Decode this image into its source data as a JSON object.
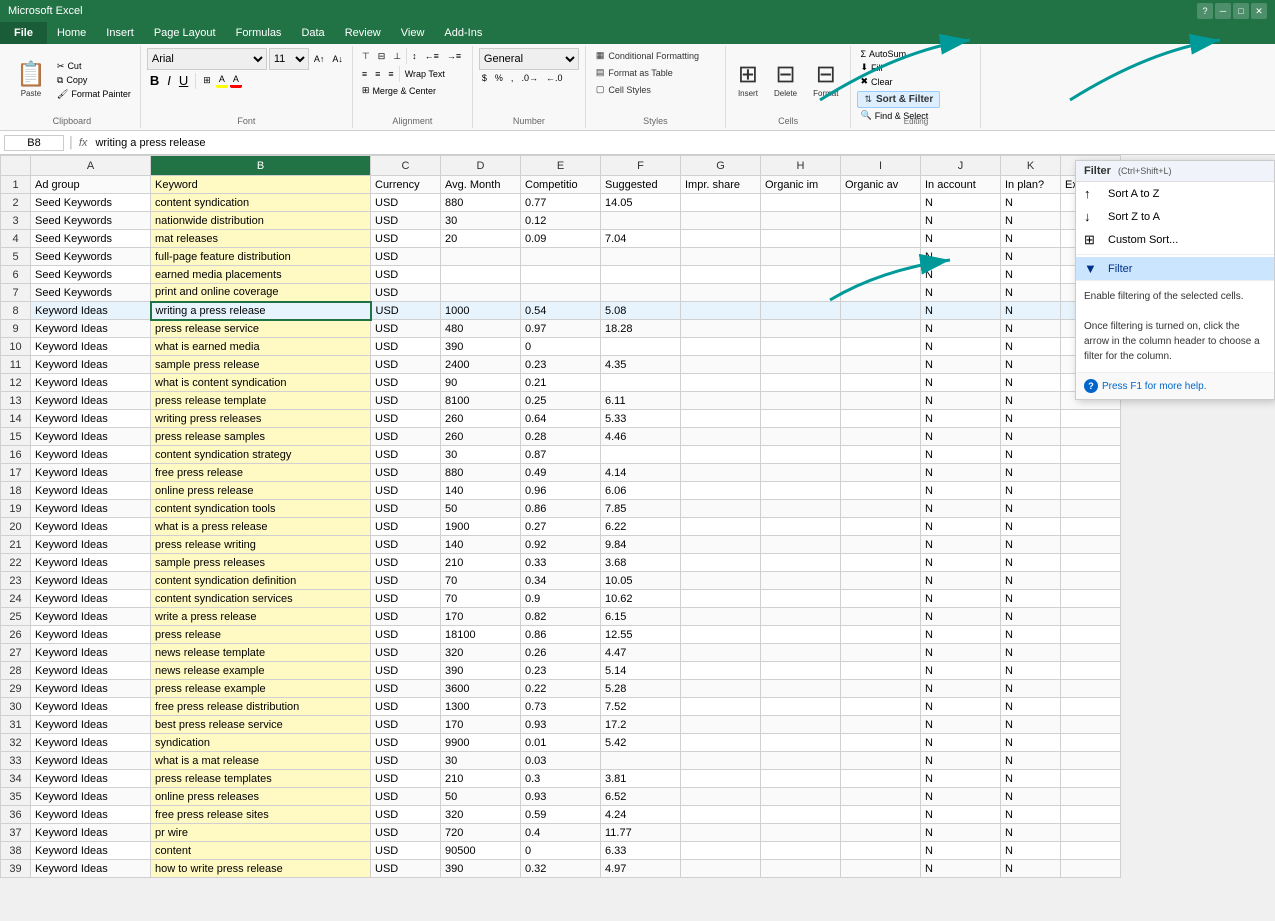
{
  "titleBar": {
    "title": "Microsoft Excel",
    "fileBtn": "File",
    "menus": [
      "Home",
      "Insert",
      "Page Layout",
      "Formulas",
      "Data",
      "Review",
      "View",
      "Add-Ins"
    ],
    "windowControls": [
      "?",
      "─",
      "□",
      "✕"
    ]
  },
  "ribbon": {
    "clipboard": {
      "label": "Clipboard",
      "paste": "Paste",
      "cut": "Cut",
      "copy": "Copy",
      "formatPainter": "Format Painter"
    },
    "font": {
      "label": "Font",
      "fontName": "Arial",
      "fontSize": "11",
      "bold": "B",
      "italic": "I",
      "underline": "U"
    },
    "alignment": {
      "label": "Alignment",
      "wrapText": "Wrap Text",
      "mergeCenter": "Merge & Center"
    },
    "number": {
      "label": "Number",
      "format": "General"
    },
    "styles": {
      "label": "Styles",
      "conditionalFormatting": "Conditional Formatting",
      "formatAsTable": "Format as Table",
      "cellStyles": "Cell Styles"
    },
    "cells": {
      "label": "Cells",
      "insert": "Insert",
      "delete": "Delete",
      "format": "Format"
    },
    "editing": {
      "label": "Editing",
      "autoSum": "AutoSum",
      "fill": "Fill",
      "clear": "Clear",
      "sortFilter": "Sort & Filter",
      "findSelect": "Find & Select"
    }
  },
  "formulaBar": {
    "cellRef": "B8",
    "formula": "writing a press release"
  },
  "columns": {
    "headers": [
      "",
      "A",
      "B",
      "C",
      "D",
      "E",
      "F",
      "G",
      "H",
      "I",
      "J",
      "K"
    ],
    "labels": {
      "A": "Ad group",
      "B": "Keyword",
      "C": "Currency",
      "D": "Avg. Month",
      "E": "Competitio",
      "F": "Suggested",
      "G": "Impr. share",
      "H": "Organic im",
      "I": "Organic av",
      "J": "In account",
      "K": "In plan?"
    }
  },
  "rows": [
    {
      "row": 2,
      "a": "Seed Keywords",
      "b": "content syndication",
      "c": "USD",
      "d": "880",
      "e": "0.77",
      "f": "14.05",
      "g": "",
      "h": "",
      "i": "",
      "j": "N",
      "k": "N"
    },
    {
      "row": 3,
      "a": "Seed Keywords",
      "b": "nationwide distribution",
      "c": "USD",
      "d": "30",
      "e": "0.12",
      "f": "",
      "g": "",
      "h": "",
      "i": "",
      "j": "N",
      "k": "N"
    },
    {
      "row": 4,
      "a": "Seed Keywords",
      "b": "mat releases",
      "c": "USD",
      "d": "20",
      "e": "0.09",
      "f": "7.04",
      "g": "",
      "h": "",
      "i": "",
      "j": "N",
      "k": "N"
    },
    {
      "row": 5,
      "a": "Seed Keywords",
      "b": "full-page feature distribution",
      "c": "USD",
      "d": "",
      "e": "",
      "f": "",
      "g": "",
      "h": "",
      "i": "",
      "j": "N",
      "k": "N"
    },
    {
      "row": 6,
      "a": "Seed Keywords",
      "b": "earned media placements",
      "c": "USD",
      "d": "",
      "e": "",
      "f": "",
      "g": "",
      "h": "",
      "i": "",
      "j": "N",
      "k": "N"
    },
    {
      "row": 7,
      "a": "Seed Keywords",
      "b": "print and online coverage",
      "c": "USD",
      "d": "",
      "e": "",
      "f": "",
      "g": "",
      "h": "",
      "i": "",
      "j": "N",
      "k": "N"
    },
    {
      "row": 8,
      "a": "Keyword Ideas",
      "b": "writing a press release",
      "c": "USD",
      "d": "1000",
      "e": "0.54",
      "f": "5.08",
      "g": "",
      "h": "",
      "i": "",
      "j": "N",
      "k": "N",
      "selected": true
    },
    {
      "row": 9,
      "a": "Keyword Ideas",
      "b": "press release service",
      "c": "USD",
      "d": "480",
      "e": "0.97",
      "f": "18.28",
      "g": "",
      "h": "",
      "i": "",
      "j": "N",
      "k": "N"
    },
    {
      "row": 10,
      "a": "Keyword Ideas",
      "b": "what is earned media",
      "c": "USD",
      "d": "390",
      "e": "0",
      "f": "",
      "g": "",
      "h": "",
      "i": "",
      "j": "N",
      "k": "N"
    },
    {
      "row": 11,
      "a": "Keyword Ideas",
      "b": "sample press release",
      "c": "USD",
      "d": "2400",
      "e": "0.23",
      "f": "4.35",
      "g": "",
      "h": "",
      "i": "",
      "j": "N",
      "k": "N"
    },
    {
      "row": 12,
      "a": "Keyword Ideas",
      "b": "what is content syndication",
      "c": "USD",
      "d": "90",
      "e": "0.21",
      "f": "",
      "g": "",
      "h": "",
      "i": "",
      "j": "N",
      "k": "N"
    },
    {
      "row": 13,
      "a": "Keyword Ideas",
      "b": "press release template",
      "c": "USD",
      "d": "8100",
      "e": "0.25",
      "f": "6.11",
      "g": "",
      "h": "",
      "i": "",
      "j": "N",
      "k": "N"
    },
    {
      "row": 14,
      "a": "Keyword Ideas",
      "b": "writing press releases",
      "c": "USD",
      "d": "260",
      "e": "0.64",
      "f": "5.33",
      "g": "",
      "h": "",
      "i": "",
      "j": "N",
      "k": "N"
    },
    {
      "row": 15,
      "a": "Keyword Ideas",
      "b": "press release samples",
      "c": "USD",
      "d": "260",
      "e": "0.28",
      "f": "4.46",
      "g": "",
      "h": "",
      "i": "",
      "j": "N",
      "k": "N"
    },
    {
      "row": 16,
      "a": "Keyword Ideas",
      "b": "content syndication strategy",
      "c": "USD",
      "d": "30",
      "e": "0.87",
      "f": "",
      "g": "",
      "h": "",
      "i": "",
      "j": "N",
      "k": "N"
    },
    {
      "row": 17,
      "a": "Keyword Ideas",
      "b": "free press release",
      "c": "USD",
      "d": "880",
      "e": "0.49",
      "f": "4.14",
      "g": "",
      "h": "",
      "i": "",
      "j": "N",
      "k": "N"
    },
    {
      "row": 18,
      "a": "Keyword Ideas",
      "b": "online press release",
      "c": "USD",
      "d": "140",
      "e": "0.96",
      "f": "6.06",
      "g": "",
      "h": "",
      "i": "",
      "j": "N",
      "k": "N"
    },
    {
      "row": 19,
      "a": "Keyword Ideas",
      "b": "content syndication tools",
      "c": "USD",
      "d": "50",
      "e": "0.86",
      "f": "7.85",
      "g": "",
      "h": "",
      "i": "",
      "j": "N",
      "k": "N"
    },
    {
      "row": 20,
      "a": "Keyword Ideas",
      "b": "what is a press release",
      "c": "USD",
      "d": "1900",
      "e": "0.27",
      "f": "6.22",
      "g": "",
      "h": "",
      "i": "",
      "j": "N",
      "k": "N"
    },
    {
      "row": 21,
      "a": "Keyword Ideas",
      "b": "press release writing",
      "c": "USD",
      "d": "140",
      "e": "0.92",
      "f": "9.84",
      "g": "",
      "h": "",
      "i": "",
      "j": "N",
      "k": "N"
    },
    {
      "row": 22,
      "a": "Keyword Ideas",
      "b": "sample press releases",
      "c": "USD",
      "d": "210",
      "e": "0.33",
      "f": "3.68",
      "g": "",
      "h": "",
      "i": "",
      "j": "N",
      "k": "N"
    },
    {
      "row": 23,
      "a": "Keyword Ideas",
      "b": "content syndication definition",
      "c": "USD",
      "d": "70",
      "e": "0.34",
      "f": "10.05",
      "g": "",
      "h": "",
      "i": "",
      "j": "N",
      "k": "N"
    },
    {
      "row": 24,
      "a": "Keyword Ideas",
      "b": "content syndication services",
      "c": "USD",
      "d": "70",
      "e": "0.9",
      "f": "10.62",
      "g": "",
      "h": "",
      "i": "",
      "j": "N",
      "k": "N"
    },
    {
      "row": 25,
      "a": "Keyword Ideas",
      "b": "write a press release",
      "c": "USD",
      "d": "170",
      "e": "0.82",
      "f": "6.15",
      "g": "",
      "h": "",
      "i": "",
      "j": "N",
      "k": "N"
    },
    {
      "row": 26,
      "a": "Keyword Ideas",
      "b": "press release",
      "c": "USD",
      "d": "18100",
      "e": "0.86",
      "f": "12.55",
      "g": "",
      "h": "",
      "i": "",
      "j": "N",
      "k": "N"
    },
    {
      "row": 27,
      "a": "Keyword Ideas",
      "b": "news release template",
      "c": "USD",
      "d": "320",
      "e": "0.26",
      "f": "4.47",
      "g": "",
      "h": "",
      "i": "",
      "j": "N",
      "k": "N"
    },
    {
      "row": 28,
      "a": "Keyword Ideas",
      "b": "news release example",
      "c": "USD",
      "d": "390",
      "e": "0.23",
      "f": "5.14",
      "g": "",
      "h": "",
      "i": "",
      "j": "N",
      "k": "N"
    },
    {
      "row": 29,
      "a": "Keyword Ideas",
      "b": "press release example",
      "c": "USD",
      "d": "3600",
      "e": "0.22",
      "f": "5.28",
      "g": "",
      "h": "",
      "i": "",
      "j": "N",
      "k": "N"
    },
    {
      "row": 30,
      "a": "Keyword Ideas",
      "b": "free press release distribution",
      "c": "USD",
      "d": "1300",
      "e": "0.73",
      "f": "7.52",
      "g": "",
      "h": "",
      "i": "",
      "j": "N",
      "k": "N"
    },
    {
      "row": 31,
      "a": "Keyword Ideas",
      "b": "best press release service",
      "c": "USD",
      "d": "170",
      "e": "0.93",
      "f": "17.2",
      "g": "",
      "h": "",
      "i": "",
      "j": "N",
      "k": "N"
    },
    {
      "row": 32,
      "a": "Keyword Ideas",
      "b": "syndication",
      "c": "USD",
      "d": "9900",
      "e": "0.01",
      "f": "5.42",
      "g": "",
      "h": "",
      "i": "",
      "j": "N",
      "k": "N"
    },
    {
      "row": 33,
      "a": "Keyword Ideas",
      "b": "what is a mat release",
      "c": "USD",
      "d": "30",
      "e": "0.03",
      "f": "",
      "g": "",
      "h": "",
      "i": "",
      "j": "N",
      "k": "N"
    },
    {
      "row": 34,
      "a": "Keyword Ideas",
      "b": "press release templates",
      "c": "USD",
      "d": "210",
      "e": "0.3",
      "f": "3.81",
      "g": "",
      "h": "",
      "i": "",
      "j": "N",
      "k": "N"
    },
    {
      "row": 35,
      "a": "Keyword Ideas",
      "b": "online press releases",
      "c": "USD",
      "d": "50",
      "e": "0.93",
      "f": "6.52",
      "g": "",
      "h": "",
      "i": "",
      "j": "N",
      "k": "N"
    },
    {
      "row": 36,
      "a": "Keyword Ideas",
      "b": "free press release sites",
      "c": "USD",
      "d": "320",
      "e": "0.59",
      "f": "4.24",
      "g": "",
      "h": "",
      "i": "",
      "j": "N",
      "k": "N"
    },
    {
      "row": 37,
      "a": "Keyword Ideas",
      "b": "pr wire",
      "c": "USD",
      "d": "720",
      "e": "0.4",
      "f": "11.77",
      "g": "",
      "h": "",
      "i": "",
      "j": "N",
      "k": "N"
    },
    {
      "row": 38,
      "a": "Keyword Ideas",
      "b": "content",
      "c": "USD",
      "d": "90500",
      "e": "0",
      "f": "6.33",
      "g": "",
      "h": "",
      "i": "",
      "j": "N",
      "k": "N"
    },
    {
      "row": 39,
      "a": "Keyword Ideas",
      "b": "how to write press release",
      "c": "USD",
      "d": "390",
      "e": "0.32",
      "f": "4.97",
      "g": "",
      "h": "",
      "i": "",
      "j": "N",
      "k": "N"
    }
  ],
  "filterPopup": {
    "title": "Filter",
    "shortcut": "(Ctrl+Shift+L)",
    "items": [
      {
        "label": "Sort A to Z",
        "icon": "↑A"
      },
      {
        "label": "Sort Z to A",
        "icon": "↓Z"
      },
      {
        "label": "Custom Sort...",
        "icon": "⊞"
      },
      {
        "label": "Filter",
        "icon": "▼",
        "active": true
      }
    ],
    "description": "Enable filtering of the selected cells.\n\nOnce filtering is turned on, click the arrow in the column header to choose a filter for the column.",
    "helpText": "Press F1 for more help."
  }
}
